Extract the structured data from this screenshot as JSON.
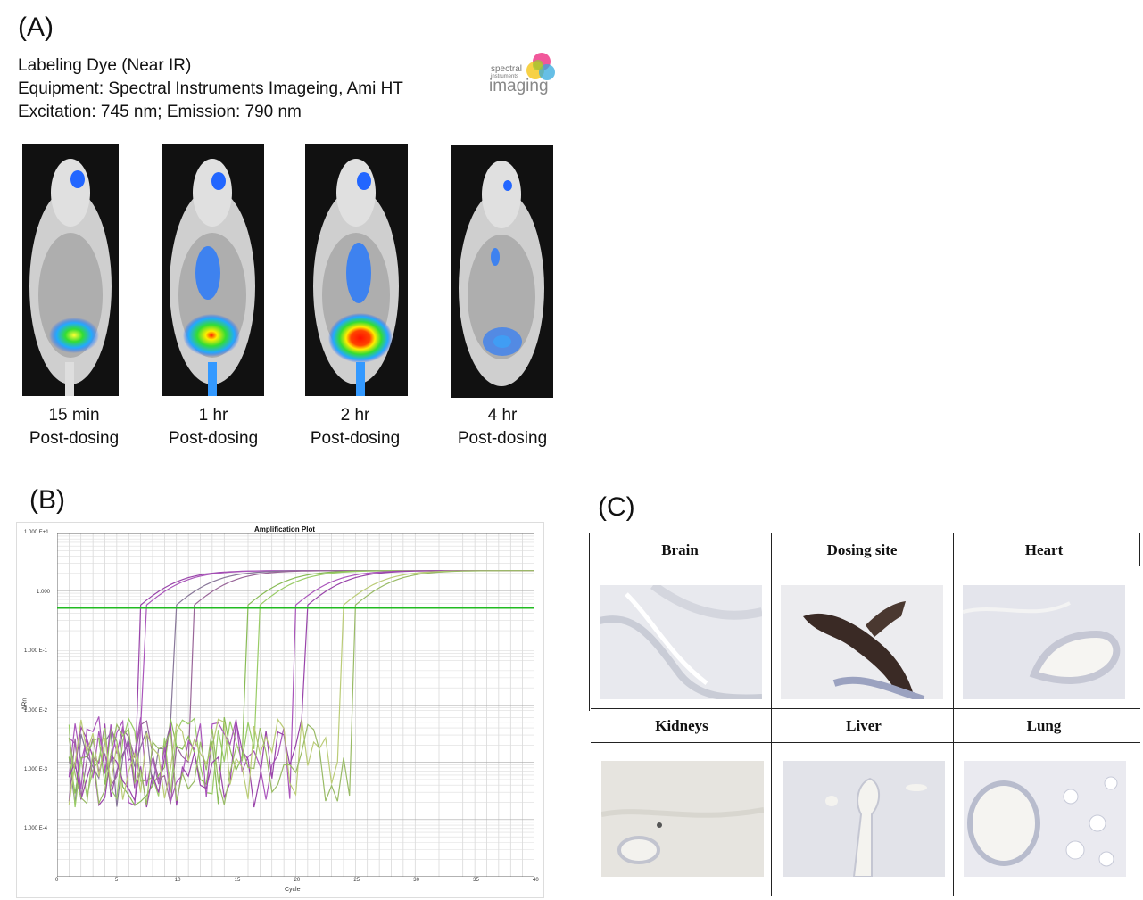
{
  "panels": {
    "a_label": "(A)",
    "b_label": "(B)",
    "c_label": "(C)"
  },
  "panel_a": {
    "info_lines": [
      "Labeling Dye (Near IR)",
      "Equipment: Spectral Instruments Imageing, Ami HT",
      "Excitation: 745 nm; Emission: 790 nm"
    ],
    "logo": {
      "line1": "spectral",
      "line2": "instruments",
      "line3": "imaging"
    },
    "timepoints": [
      {
        "time": "15 min",
        "label": "Post-dosing",
        "intensity": 0.55
      },
      {
        "time": "1 hr",
        "label": "Post-dosing",
        "intensity": 0.8
      },
      {
        "time": "2 hr",
        "label": "Post-dosing",
        "intensity": 1.0
      },
      {
        "time": "4 hr",
        "label": "Post-dosing",
        "intensity": 0.3
      }
    ]
  },
  "panel_b": {
    "title": "Amplification Plot",
    "xlabel": "Cycle",
    "ylabel": "ΔRn",
    "x_ticks": [
      "0",
      "5",
      "10",
      "15",
      "20",
      "25",
      "30",
      "35",
      "40"
    ],
    "y_ticks": [
      "1.000 E+1",
      "1.000",
      "1.000 E-1",
      "1.000 E-2",
      "1.000 E-3",
      "1.000 E-4"
    ],
    "threshold_color": "#22bb22"
  },
  "chart_data": {
    "type": "line",
    "title": "Amplification Plot",
    "xlabel": "Cycle",
    "ylabel": "ΔRn",
    "xlim": [
      0,
      40
    ],
    "ylim_log10": [
      -5,
      1
    ],
    "yscale": "log",
    "grid": true,
    "threshold": 0.5,
    "series_ct": [
      9,
      9.5,
      12,
      13.5,
      18,
      19,
      22,
      23,
      26,
      27
    ]
  },
  "panel_c": {
    "tissues_row1": [
      "Brain",
      "Dosing site",
      "Heart"
    ],
    "tissues_row2": [
      "Kidneys",
      "Liver",
      "Lung"
    ]
  }
}
